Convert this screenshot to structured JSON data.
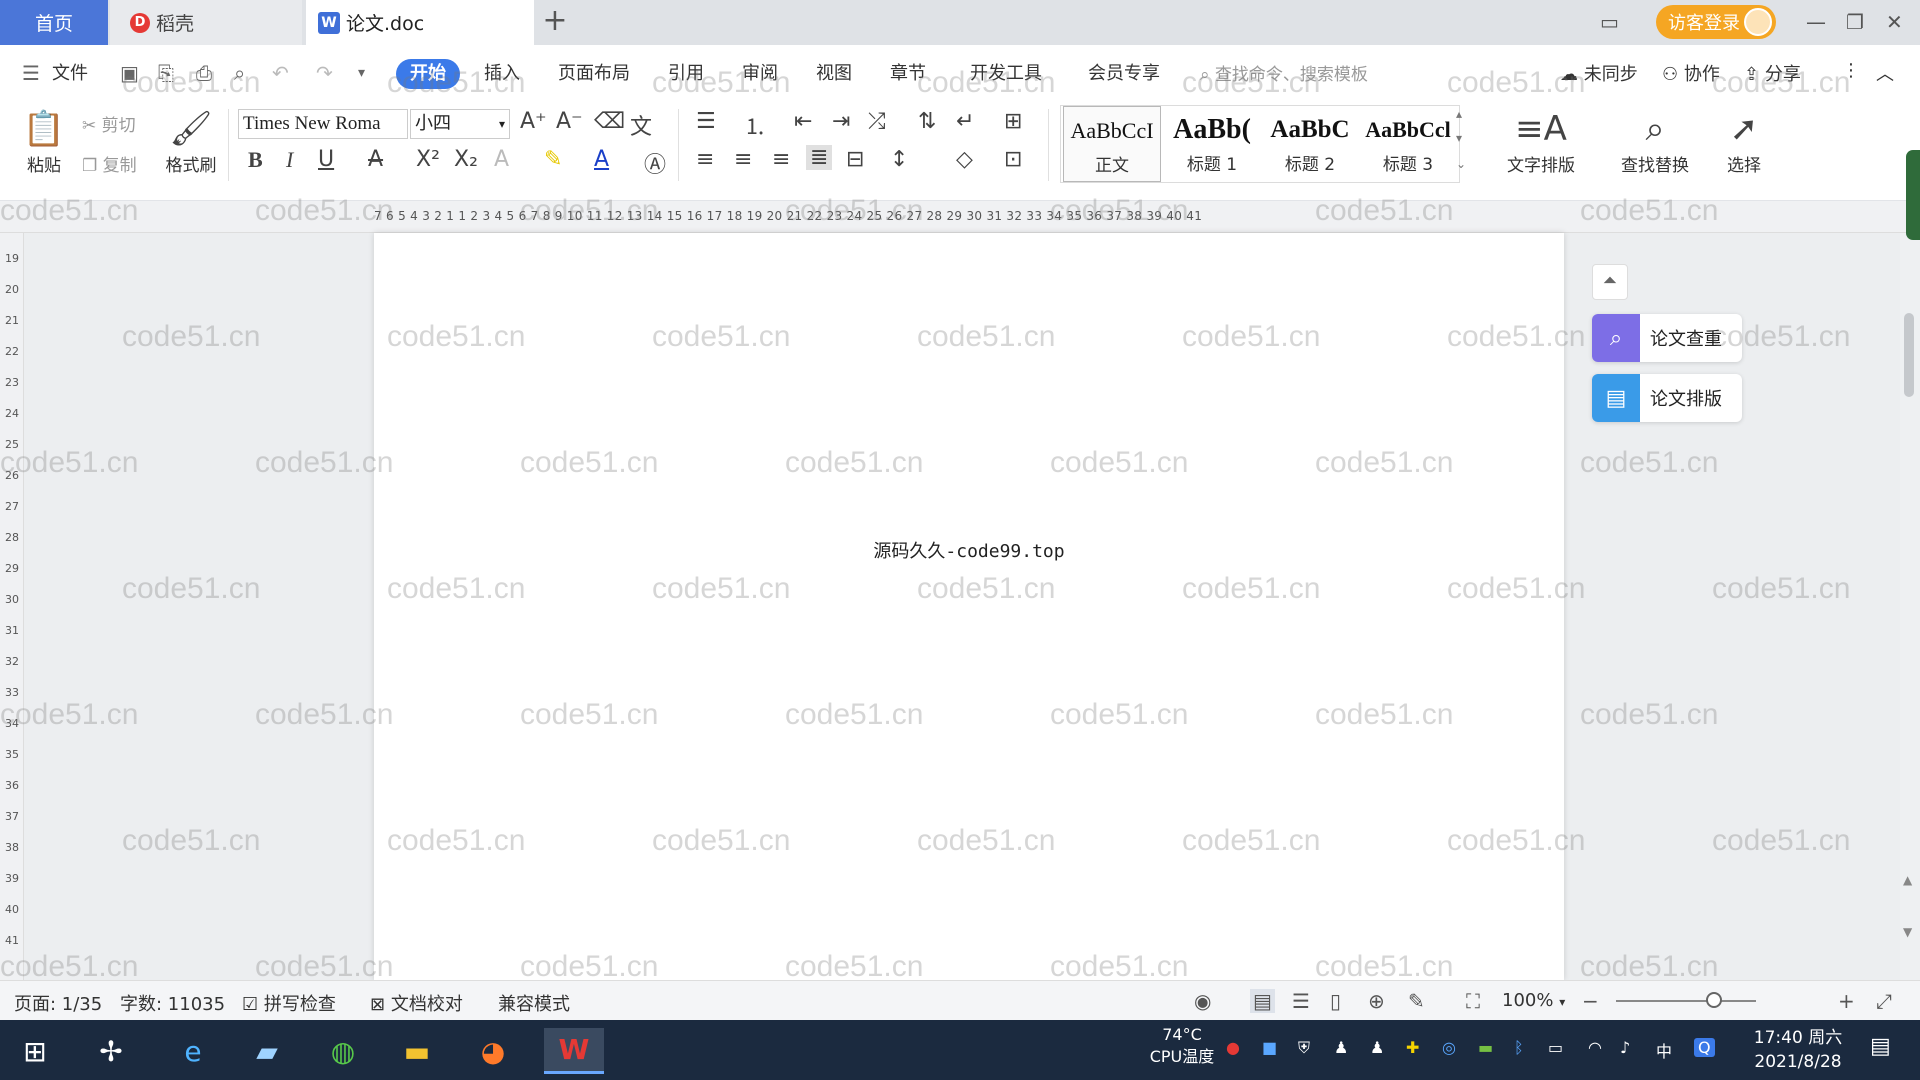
{
  "tabs": {
    "home": "首页",
    "wps": "稻壳",
    "doc": "论文.doc",
    "new_tab": "+"
  },
  "title_bar": {
    "login": "访客登录"
  },
  "menu": {
    "file": "文件",
    "items": [
      "开始",
      "插入",
      "页面布局",
      "引用",
      "审阅",
      "视图",
      "章节",
      "开发工具",
      "会员专享"
    ],
    "search_placeholder": "查找命令、搜索模板",
    "sync": "未同步",
    "collab": "协作",
    "share": "分享"
  },
  "ribbon": {
    "paste": "粘贴",
    "cut": "剪切",
    "copy": "复制",
    "format_painter": "格式刷",
    "font_name": "Times New Roma",
    "font_size": "小四",
    "styles": [
      {
        "sample": "AaBbCcI",
        "label": "正文"
      },
      {
        "sample": "AaBb(",
        "label": "标题 1"
      },
      {
        "sample": "AaBbC",
        "label": "标题 2"
      },
      {
        "sample": "AaBbCcl",
        "label": "标题 3"
      }
    ],
    "text_layout": "文字排版",
    "find_replace": "查找替换",
    "select": "选择"
  },
  "ruler": {
    "numbers": "7 6 5 4 3 2 1  1 2 3 4 5 6 7 8 9 10 11 12 13 14 15 16 17 18 19 20 21 22 23 24 25 26 27 28 29 30 31 32 33 34 35 36 37 38 39 40 41",
    "vertical": [
      "19",
      "20",
      "21",
      "22",
      "23",
      "24",
      "25",
      "26",
      "27",
      "28",
      "29",
      "30",
      "31",
      "32",
      "33",
      "34",
      "35",
      "36",
      "37",
      "38",
      "39",
      "40",
      "41"
    ]
  },
  "document": {
    "text": "源码久久-code99.top"
  },
  "side_panel": {
    "check": "论文查重",
    "layout": "论文排版"
  },
  "watermark": "code51.cn",
  "status": {
    "page": "页面: 1/35",
    "words": "字数: 11035",
    "spell": "拼写检查",
    "proof": "文档校对",
    "compat": "兼容模式",
    "zoom": "100%"
  },
  "taskbar": {
    "cpu_temp": "74°C",
    "cpu_label": "CPU温度",
    "ime": "中",
    "time": "17:40 周六",
    "date": "2021/8/28"
  },
  "colors": {
    "accent": "#3b7ae9",
    "home_tab": "#4b76d8",
    "login": "#f5a623",
    "taskbar": "#1b2a3f"
  }
}
